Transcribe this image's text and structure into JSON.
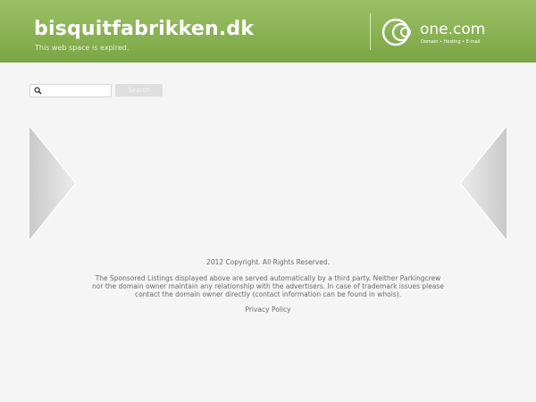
{
  "header": {
    "site_title": "bisquitfabrikken.dk",
    "site_subtitle": "This web space is expired.",
    "brand_name": "one.com",
    "brand_tagline": "Domain • Hosting • E-mail",
    "background_color": "#8cb457"
  },
  "search": {
    "input_value": "",
    "button_label": "Search",
    "icon": "search-icon"
  },
  "navigation": {
    "left_icon": "arrow-left-icon",
    "right_icon": "arrow-right-icon"
  },
  "footer": {
    "copyright": "2012 Copyright. All Rights Reserved.",
    "disclaimer": "The Sponsored Listings displayed above are served automatically by a third party. Neither Parkingcrew nor the domain owner maintain any relationship with the advertisers. In case of trademark issues please contact the domain owner directly (contact information can be found in whois).",
    "privacy_link": "Privacy Policy"
  }
}
